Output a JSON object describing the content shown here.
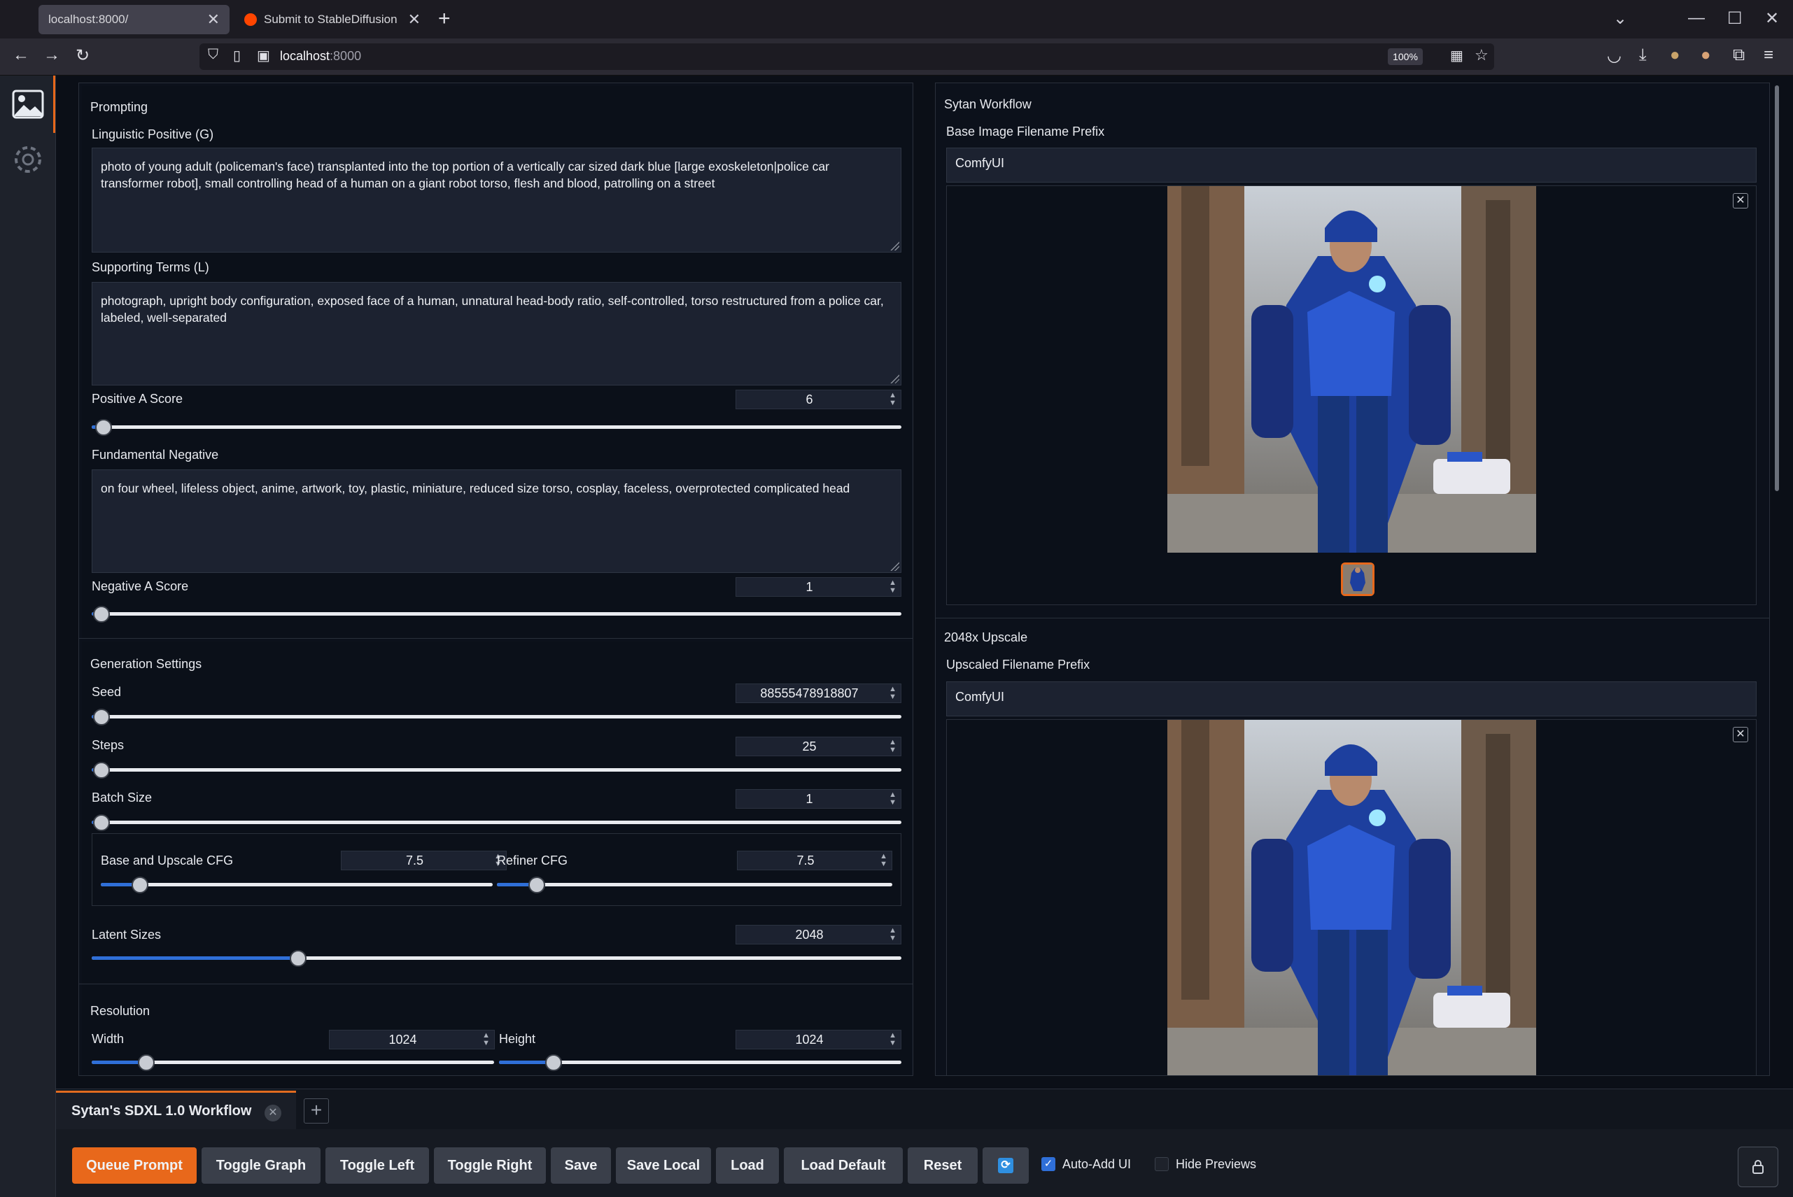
{
  "browser": {
    "tabs": [
      {
        "label": "localhost:8000/",
        "active": true
      },
      {
        "label": "Submit to StableDiffusion",
        "active": false
      }
    ],
    "url_host": "localhost",
    "url_port": ":8000",
    "zoom": "100%"
  },
  "left_panel": {
    "prompting": {
      "title": "Prompting",
      "linguistic_positive": {
        "label": "Linguistic Positive (G)",
        "value": "photo of young adult (policeman's face) transplanted into the top portion of a vertically car sized dark blue [large exoskeleton|police car transformer robot], small controlling head of a human on a giant robot torso, flesh and blood, patrolling on a street"
      },
      "supporting_terms": {
        "label": "Supporting Terms (L)",
        "value": "photograph, upright body configuration, exposed face of a human, unnatural head-body ratio, self-controlled, torso restructured from a police car, labeled, well-separated"
      },
      "positive_a_score": {
        "label": "Positive A Score",
        "value": "6",
        "fraction": 0.015
      },
      "fundamental_negative": {
        "label": "Fundamental Negative",
        "value": "on four wheel, lifeless object, anime, artwork, toy, plastic, miniature, reduced size torso, cosplay, faceless, overprotected complicated head"
      },
      "negative_a_score": {
        "label": "Negative A Score",
        "value": "1",
        "fraction": 0.012
      }
    },
    "generation": {
      "title": "Generation Settings",
      "seed": {
        "label": "Seed",
        "value": "88555478918807",
        "fraction": 0.012
      },
      "steps": {
        "label": "Steps",
        "value": "25",
        "fraction": 0.012
      },
      "batch_size": {
        "label": "Batch Size",
        "value": "1",
        "fraction": 0.012
      },
      "base_cfg": {
        "label": "Base and Upscale CFG",
        "value": "7.5",
        "fraction": 0.1
      },
      "refiner_cfg": {
        "label": "Refiner CFG",
        "value": "7.5",
        "fraction": 0.1
      },
      "latent_sizes": {
        "label": "Latent Sizes",
        "value": "2048",
        "fraction": 0.255
      }
    },
    "resolution": {
      "title": "Resolution",
      "width": {
        "label": "Width",
        "value": "1024",
        "fraction": 0.135
      },
      "height": {
        "label": "Height",
        "value": "1024",
        "fraction": 0.135
      }
    }
  },
  "right_panel": {
    "sytan": {
      "title": "Sytan Workflow",
      "prefix_label": "Base Image Filename Prefix",
      "prefix_value": "ComfyUI"
    },
    "upscale": {
      "title": "2048x Upscale",
      "prefix_label": "Upscaled Filename Prefix",
      "prefix_value": "ComfyUI"
    }
  },
  "workflow_tab": {
    "label": "Sytan's SDXL 1.0 Workflow"
  },
  "toolbar": {
    "queue_prompt": "Queue Prompt",
    "toggle_graph": "Toggle Graph",
    "toggle_left": "Toggle Left",
    "toggle_right": "Toggle Right",
    "save": "Save",
    "save_local": "Save Local",
    "load": "Load",
    "load_default": "Load Default",
    "reset": "Reset",
    "auto_add_ui": "Auto-Add UI",
    "auto_add_ui_checked": true,
    "hide_previews": "Hide Previews",
    "hide_previews_checked": false
  },
  "colors": {
    "accent": "#e8681b",
    "slider_fill": "#2f6fd8",
    "robot_blue": "#1d3f9e"
  }
}
